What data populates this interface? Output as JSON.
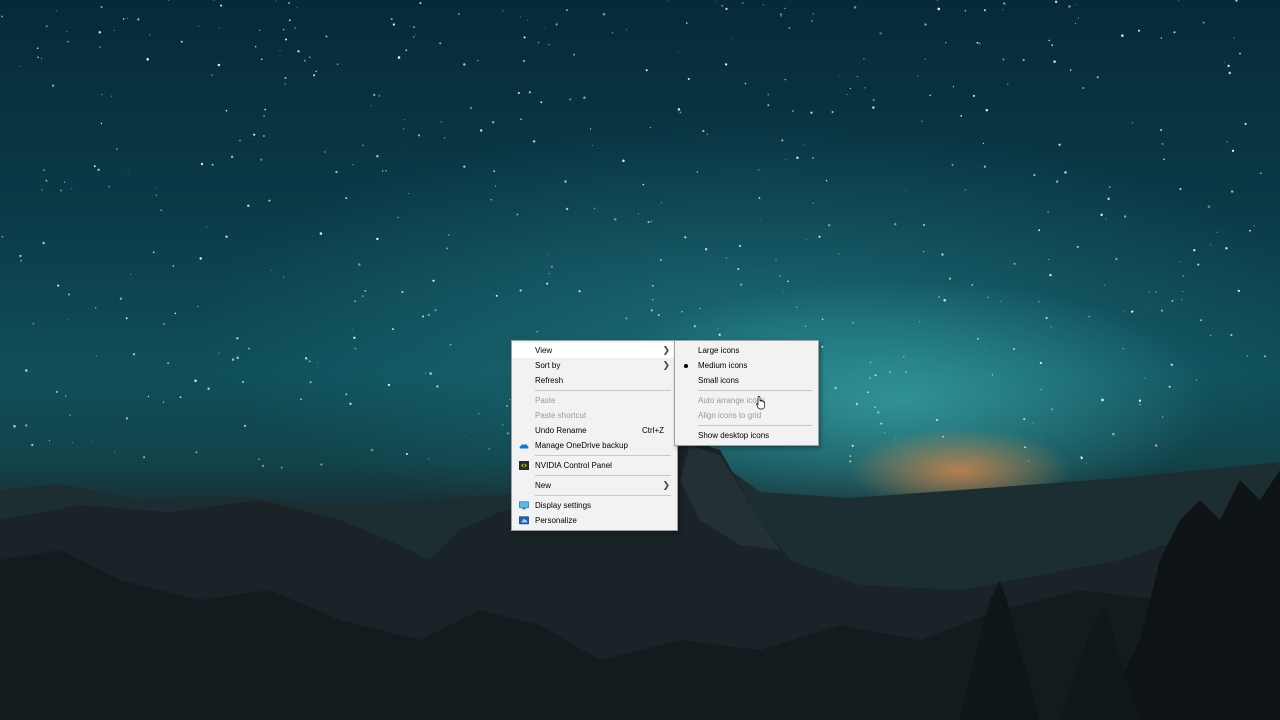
{
  "context_menu": {
    "view": "View",
    "sort_by": "Sort by",
    "refresh": "Refresh",
    "paste": "Paste",
    "paste_shortcut": "Paste shortcut",
    "undo_rename": "Undo Rename",
    "undo_rename_shortcut": "Ctrl+Z",
    "manage_onedrive": "Manage OneDrive backup",
    "nvidia_panel": "NVIDIA Control Panel",
    "new": "New",
    "display_settings": "Display settings",
    "personalize": "Personalize"
  },
  "view_submenu": {
    "large_icons": "Large icons",
    "medium_icons": "Medium icons",
    "small_icons": "Small icons",
    "auto_arrange": "Auto arrange icons",
    "align_to_grid": "Align icons to grid",
    "show_desktop_icons": "Show desktop icons",
    "selected": "Medium icons"
  },
  "icons": {
    "onedrive": "onedrive-cloud-icon",
    "nvidia": "nvidia-icon",
    "display": "display-monitor-icon",
    "personalize": "personalize-icon",
    "cursor": "mouse-pointer-icon"
  },
  "colors": {
    "menu_background": "#f2f2f2",
    "highlight": "#ffffff",
    "disabled_text": "#9a9a9a",
    "onedrive_blue": "#0f78d4",
    "nvidia_green": "#76b900"
  }
}
